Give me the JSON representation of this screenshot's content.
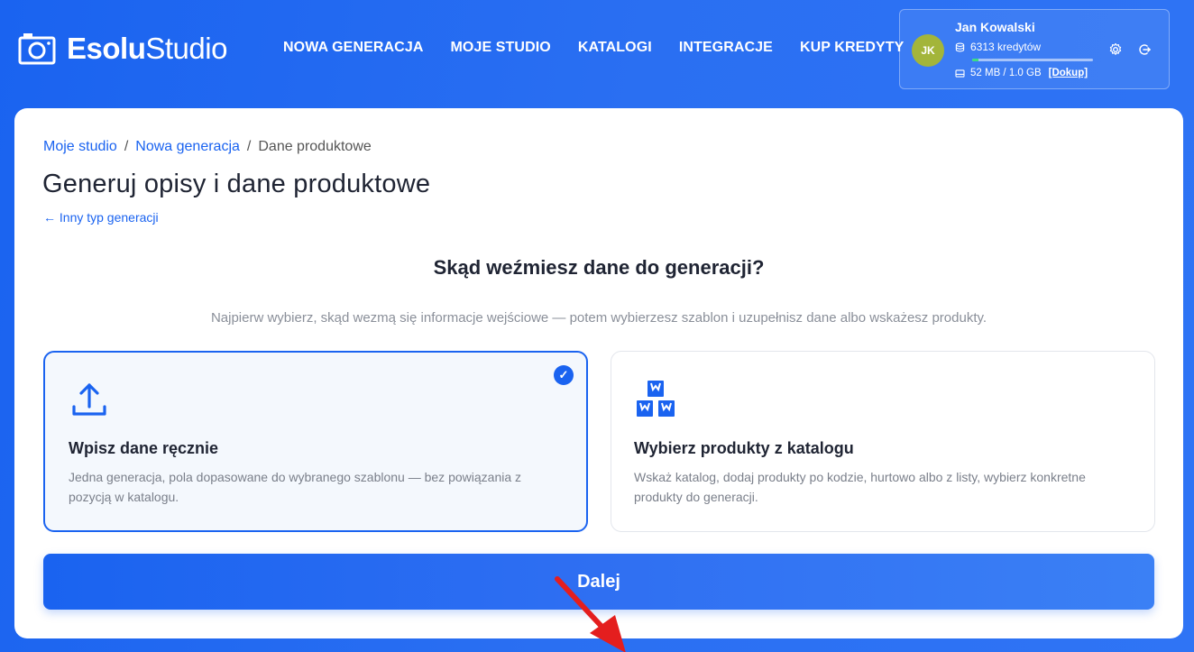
{
  "app": {
    "brand_bold": "Esolu",
    "brand_light": "Studio"
  },
  "nav": [
    {
      "label": "NOWA GENERACJA"
    },
    {
      "label": "MOJE STUDIO"
    },
    {
      "label": "KATALOGI"
    },
    {
      "label": "INTEGRACJE"
    },
    {
      "label": "KUP KREDYTY"
    }
  ],
  "user": {
    "initials": "JK",
    "name": "Jan Kowalski",
    "credits": "6313 kredytów",
    "storage": "52 MB / 1.0 GB",
    "storage_fraction": 0.05,
    "topup_label": "[Dokup]",
    "avatar_color": "#a3b53a",
    "storage_color": "#3ddc84"
  },
  "breadcrumb": {
    "items": [
      "Moje studio",
      "Nowa generacja",
      "Dane produktowe"
    ],
    "separator": "/"
  },
  "page": {
    "title": "Generuj opisy i dane produktowe",
    "back_link": "← Inny typ generacji",
    "question": "Skąd weźmiesz dane do generacji?",
    "hint": "Najpierw wybierz, skąd wezmą się informacje wejściowe — potem wybierzesz szablon i uzupełnisz dane albo wskażesz produkty."
  },
  "options": [
    {
      "title": "Wpisz dane ręcznie",
      "description": "Jedna generacja, pola dopasowane do wybranego szablonu — bez powiązania z pozycją w katalogu.",
      "icon": "upload-icon",
      "selected": true
    },
    {
      "title": "Wybierz produkty z katalogu",
      "description": "Wskaż katalog, dodaj produkty po kodzie, hurtowo albo z listy, wybierz konkretne produkty do generacji.",
      "icon": "boxes-icon",
      "selected": false
    }
  ],
  "actions": {
    "next_label": "Dalej"
  },
  "colors": {
    "accent": "#1a63f0",
    "arrow": "#e41e1e"
  }
}
